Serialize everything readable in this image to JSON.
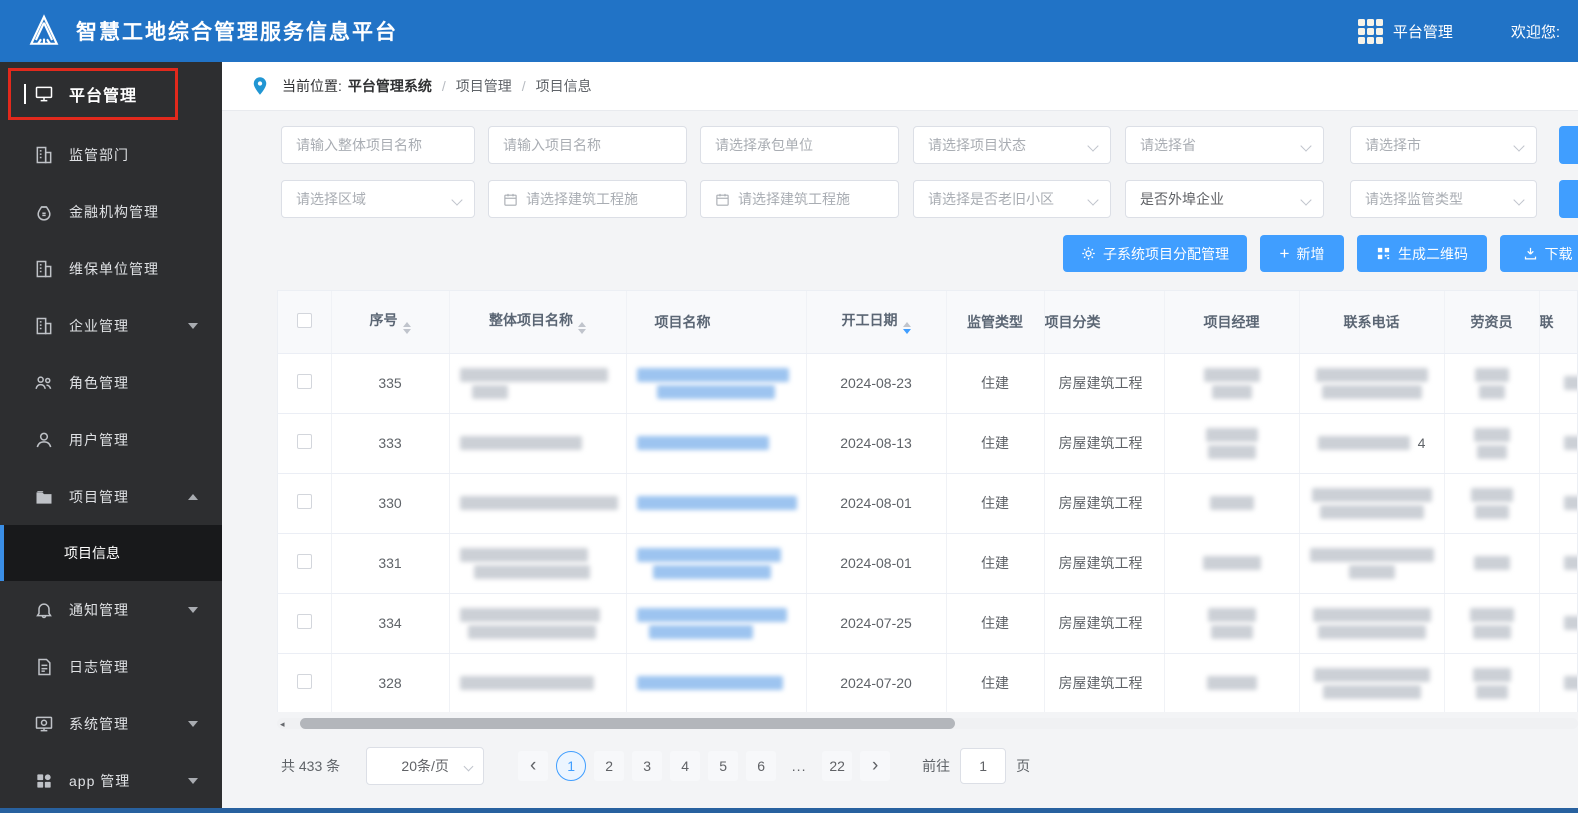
{
  "header": {
    "title": "智慧工地综合管理服务信息平台",
    "nav_label": "平台管理",
    "welcome": "欢迎您:"
  },
  "sidebar": {
    "items": [
      {
        "label": "平台管理",
        "icon": "monitor-icon"
      },
      {
        "label": "监管部门",
        "icon": "building-icon"
      },
      {
        "label": "金融机构管理",
        "icon": "moneybag-icon"
      },
      {
        "label": "维保单位管理",
        "icon": "building-icon"
      },
      {
        "label": "企业管理",
        "icon": "building-icon",
        "state": "collapsed"
      },
      {
        "label": "角色管理",
        "icon": "roles-icon"
      },
      {
        "label": "用户管理",
        "icon": "user-icon"
      },
      {
        "label": "项目管理",
        "icon": "folder-icon",
        "state": "expanded"
      },
      {
        "label": "通知管理",
        "icon": "bell-icon",
        "state": "collapsed"
      },
      {
        "label": "日志管理",
        "icon": "log-icon"
      },
      {
        "label": "系统管理",
        "icon": "system-icon",
        "state": "collapsed"
      },
      {
        "label": "app 管理",
        "icon": "app-grid-icon",
        "state": "collapsed"
      }
    ],
    "submenu": {
      "label": "项目信息",
      "active": true
    }
  },
  "breadcrumb": {
    "prefix": "当前位置:",
    "root": "平台管理系统",
    "sep": "/",
    "level2": "项目管理",
    "level3": "项目信息"
  },
  "filters": {
    "row1": [
      {
        "placeholder": "请输入整体项目名称"
      },
      {
        "placeholder": "请输入项目名称"
      },
      {
        "placeholder": "请选择承包单位"
      },
      {
        "placeholder": "请选择项目状态"
      },
      {
        "placeholder": "请选择省"
      },
      {
        "placeholder": "请选择市"
      }
    ],
    "row2": [
      {
        "placeholder": "请选择区域"
      },
      {
        "placeholder": "请选择建筑工程施"
      },
      {
        "placeholder": "请选择建筑工程施"
      },
      {
        "placeholder": "请选择是否老旧小区"
      },
      {
        "placeholder": "是否外埠企业"
      },
      {
        "placeholder": "请选择监管类型"
      }
    ]
  },
  "actions": [
    {
      "label": "子系统项目分配管理",
      "icon": "gear-icon"
    },
    {
      "label": "新增",
      "icon": "plus-icon"
    },
    {
      "label": "生成二维码",
      "icon": "qr-icon"
    },
    {
      "label": "下载",
      "icon": "download-icon"
    }
  ],
  "table": {
    "columns": [
      "序号",
      "整体项目名称",
      "项目名称",
      "开工日期",
      "监管类型",
      "项目分类",
      "项目经理",
      "联系电话",
      "劳资员",
      "联"
    ],
    "sorted_column": "开工日期",
    "rows": [
      {
        "seq": "335",
        "start_date": "2024-08-23",
        "supervision_type": "住建",
        "project_category": "房屋建筑工程",
        "phone_extra": ""
      },
      {
        "seq": "333",
        "start_date": "2024-08-13",
        "supervision_type": "住建",
        "project_category": "房屋建筑工程",
        "phone_extra": "4"
      },
      {
        "seq": "330",
        "start_date": "2024-08-01",
        "supervision_type": "住建",
        "project_category": "房屋建筑工程",
        "phone_extra": ""
      },
      {
        "seq": "331",
        "start_date": "2024-08-01",
        "supervision_type": "住建",
        "project_category": "房屋建筑工程",
        "phone_extra": ""
      },
      {
        "seq": "334",
        "start_date": "2024-07-25",
        "supervision_type": "住建",
        "project_category": "房屋建筑工程",
        "phone_extra": ""
      },
      {
        "seq": "328",
        "start_date": "2024-07-20",
        "supervision_type": "住建",
        "project_category": "房屋建筑工程",
        "phone_extra": ""
      }
    ]
  },
  "pagination": {
    "total": "共 433 条",
    "page_size": "20条/页",
    "prev_icon": "‹",
    "next_icon": "›",
    "current": "1",
    "pages": [
      "2",
      "3",
      "4",
      "5",
      "6",
      "...",
      "22"
    ],
    "goto_label": "前往",
    "goto_value": "1",
    "goto_unit": "页"
  }
}
